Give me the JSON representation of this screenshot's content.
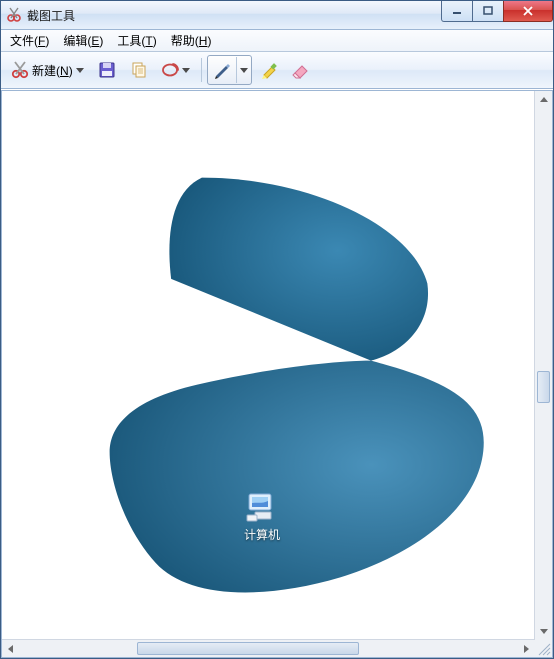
{
  "window": {
    "title": "截图工具"
  },
  "menu": {
    "file": {
      "label": "文件",
      "key": "F"
    },
    "edit": {
      "label": "编辑",
      "key": "E"
    },
    "tools": {
      "label": "工具",
      "key": "T"
    },
    "help": {
      "label": "帮助",
      "key": "H"
    }
  },
  "toolbar": {
    "new_label": "新建",
    "new_key": "N",
    "icons": {
      "new": "scissors-icon",
      "save": "save-icon",
      "copy": "copy-icon",
      "mail": "mail-icon",
      "pen": "pen-icon",
      "highlighter": "highlighter-icon",
      "eraser": "eraser-icon"
    }
  },
  "canvas": {
    "shape_color_dark": "#16597c",
    "shape_color_light": "#3b88b3",
    "desktop_icon_label": "计算机"
  }
}
